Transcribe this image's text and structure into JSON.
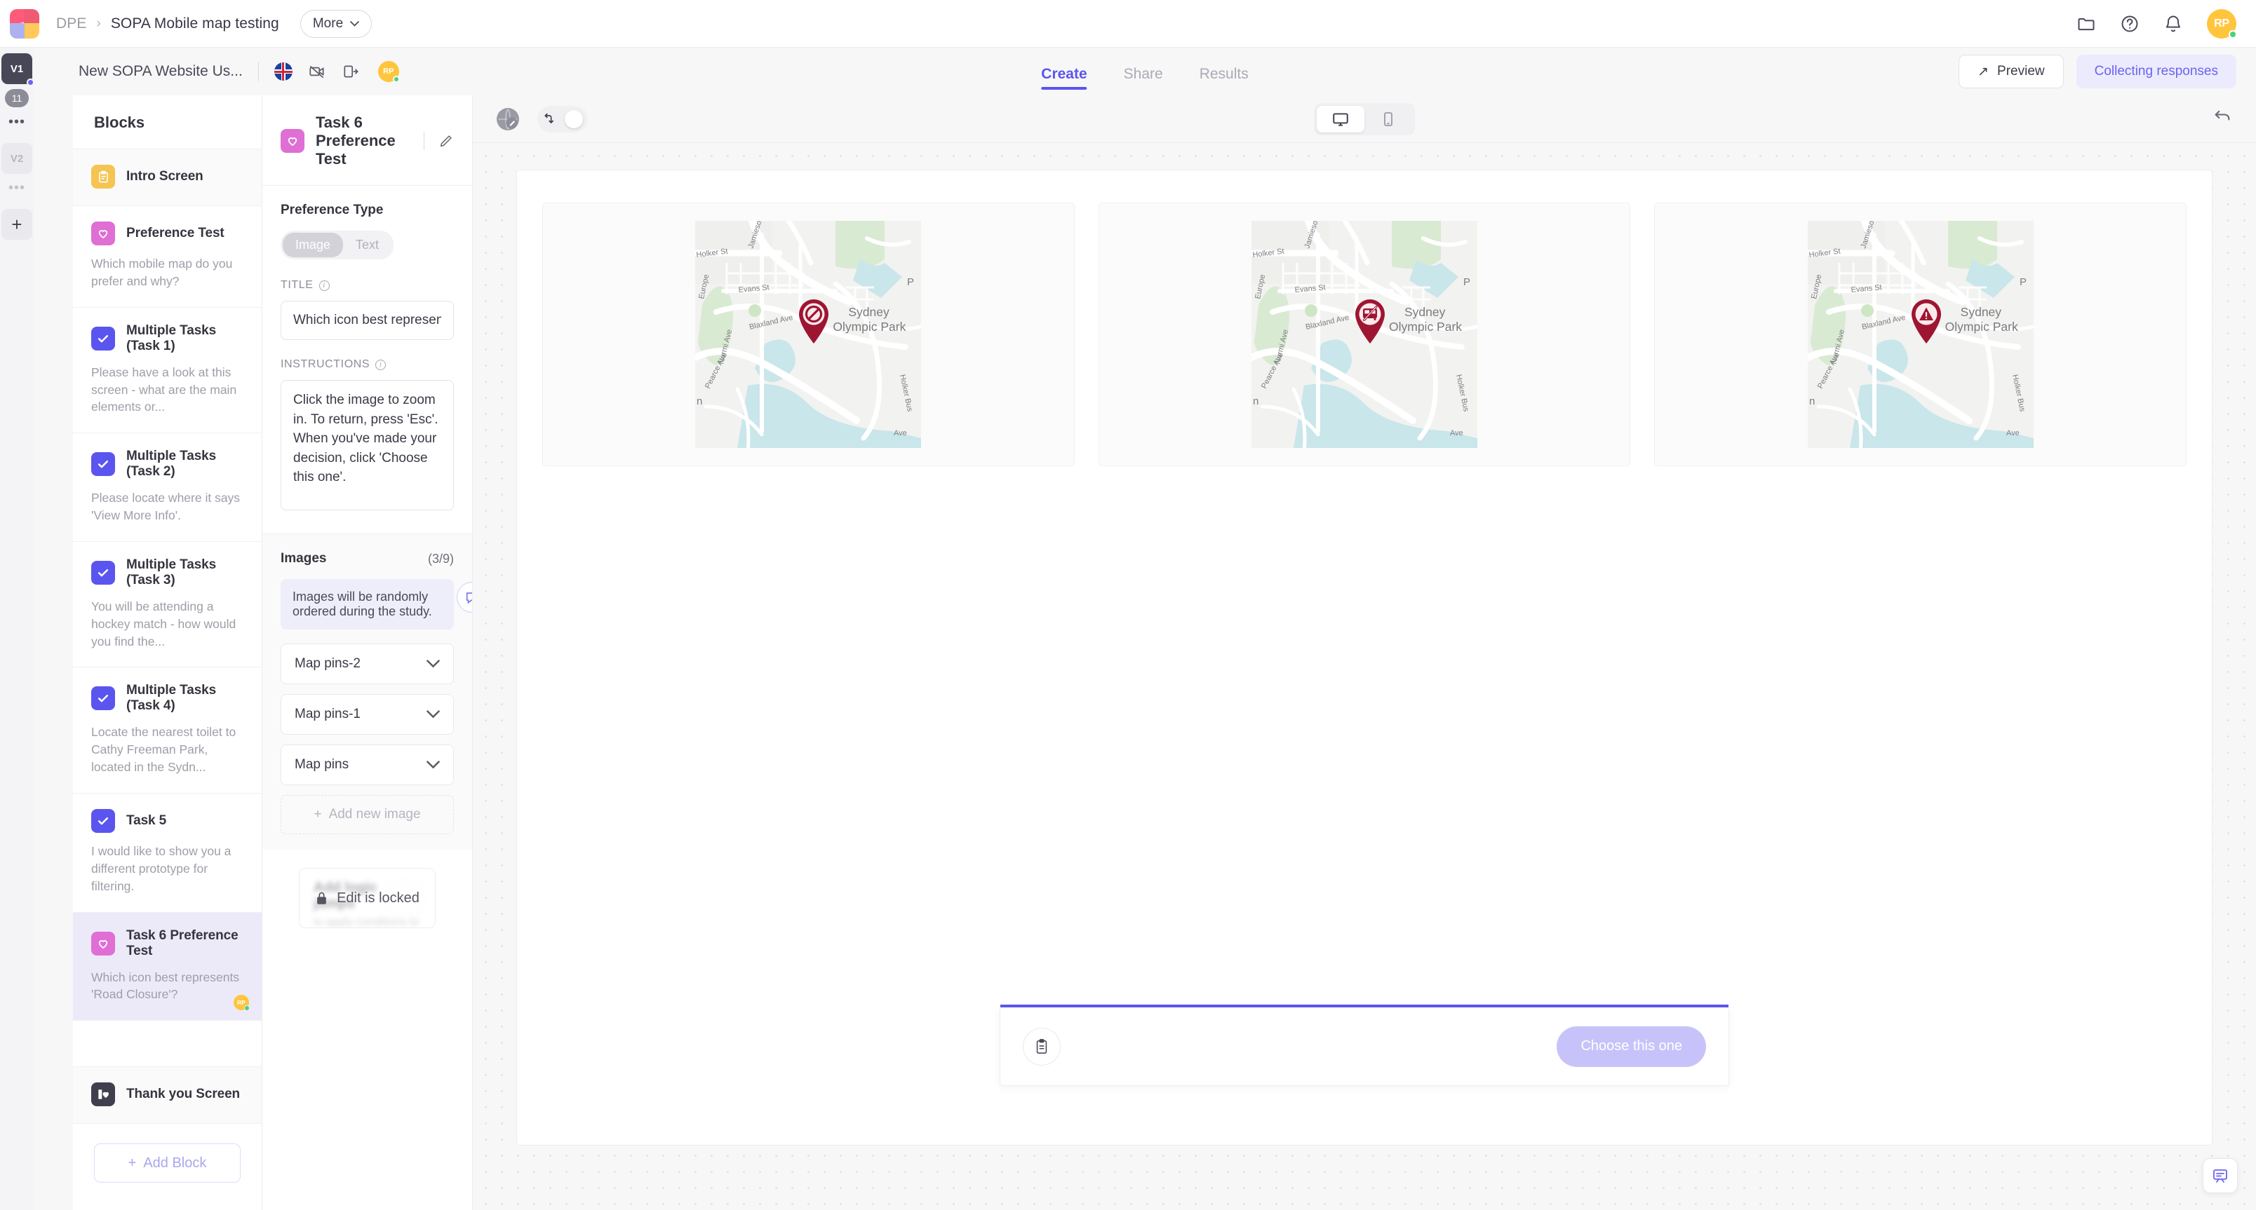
{
  "topbar": {
    "breadcrumb_root": "DPE",
    "breadcrumb_sep": "›",
    "breadcrumb_current": "SOPA Mobile map testing",
    "more_label": "More",
    "more_chevron": "⌄",
    "icons": [
      "folder-icon",
      "help-icon",
      "notifications-icon"
    ],
    "avatar_initials": "RP"
  },
  "rail": {
    "version_1": "V1",
    "badge_count": "11",
    "dots": "•••",
    "version_2": "V2",
    "dots2": "•••",
    "add": "+"
  },
  "subheader": {
    "study_name": "New SOPA Website Us...",
    "flag": "uk-flag-icon",
    "icon_no_video": "video-off-icon",
    "icon_export": "export-icon",
    "avatar_initials": "RP",
    "tabs": [
      {
        "label": "Create",
        "active": true
      },
      {
        "label": "Share",
        "active": false
      },
      {
        "label": "Results",
        "active": false
      }
    ],
    "preview_label": "Preview",
    "preview_arrow": "↗",
    "status_label": "Collecting responses"
  },
  "blocks": {
    "header": "Blocks",
    "items": [
      {
        "title": "Intro Screen",
        "desc": "",
        "icon": "clipboard-icon",
        "color": "yellow",
        "state": "shaded"
      },
      {
        "title": "Preference Test",
        "desc": "Which mobile map do you prefer and why?",
        "icon": "heart-icon",
        "color": "pink",
        "state": ""
      },
      {
        "title": "Multiple Tasks (Task 1)",
        "desc": "Please have a look at this screen - what are the main elements or...",
        "icon": "check-icon",
        "color": "purple",
        "state": ""
      },
      {
        "title": "Multiple Tasks (Task 2)",
        "desc": "Please locate where it says 'View More Info'.",
        "icon": "check-icon",
        "color": "purple",
        "state": ""
      },
      {
        "title": "Multiple Tasks (Task 3)",
        "desc": "You will be attending a hockey match - how would you find the...",
        "icon": "check-icon",
        "color": "purple",
        "state": ""
      },
      {
        "title": "Multiple Tasks (Task 4)",
        "desc": "Locate the nearest toilet to Cathy Freeman Park, located in the Sydn...",
        "icon": "check-icon",
        "color": "purple",
        "state": ""
      },
      {
        "title": "Task 5",
        "desc": "I would like to show you a different prototype for filtering.",
        "icon": "check-icon",
        "color": "purple",
        "state": ""
      },
      {
        "title": "Task 6 Preference Test",
        "desc": "Which icon best represents 'Road Closure'?",
        "icon": "heart-icon",
        "color": "pink",
        "state": "selected",
        "avatar": "RP"
      },
      {
        "title": "Thank you Screen",
        "desc": "",
        "icon": "exit-heart-icon",
        "color": "dark",
        "state": "shaded"
      }
    ],
    "add_block_label": "Add Block",
    "add_block_plus": "+"
  },
  "settings": {
    "block_title": "Task 6 Preference Test",
    "edit_icon": "pencil-icon",
    "preference_type_label": "Preference Type",
    "type_options": [
      {
        "label": "Image",
        "selected": true
      },
      {
        "label": "Text",
        "selected": false
      }
    ],
    "title_label": "TITLE",
    "title_value": "Which icon best represents 'Road Closure'?",
    "instructions_label": "INSTRUCTIONS",
    "instructions_value": "Click the image to zoom in. To return, press 'Esc'. When you've made your decision, click 'Choose this one'.",
    "images_label": "Images",
    "images_count": "(3/9)",
    "images_note": "Images will be randomly ordered during the study.",
    "image_rows": [
      {
        "name": "Map pins-2",
        "chevron": "chevron-down-icon"
      },
      {
        "name": "Map pins-1",
        "chevron": "chevron-down-icon"
      },
      {
        "name": "Map pins",
        "chevron": "chevron-down-icon"
      }
    ],
    "add_image_label": "Add new image",
    "add_image_plus": "+",
    "logic_title": "Add logic jumps",
    "logic_subtitle": "to apply conditions to your blocks",
    "locked_label": "Edit is locked",
    "lock_icon": "lock-icon",
    "comment_fab": "comment-icon"
  },
  "canvas": {
    "globe_icon": "globe-edit-icon",
    "logic_toggle_icon": "logic-jump-icon",
    "device_desktop": "desktop-icon",
    "device_mobile": "mobile-icon",
    "undo_icon": "undo-icon",
    "cards": [
      {
        "pin": "no-entry-icon",
        "label_line1": "Sydney",
        "label_line2": "Olympic Park"
      },
      {
        "pin": "no-bus-icon",
        "label_line1": "Sydney",
        "label_line2": "Olympic Park"
      },
      {
        "pin": "warning-triangle-icon",
        "label_line1": "Sydney",
        "label_line2": "Olympic Park"
      }
    ],
    "map_streets": [
      "Holker St",
      "Jamieson",
      "Evans St",
      "Europe",
      "Blaxland Ave",
      "Nurmi Ave",
      "Pearce Ave",
      "Holker Bus",
      "Ave",
      "P",
      "n"
    ],
    "bottom_clip_icon": "clipboard-icon",
    "choose_label": "Choose this one",
    "fab_icon": "feedback-icon"
  },
  "colors": {
    "accent": "#5b55ef",
    "pin_red": "#9e1532",
    "pink": "#df6fd4",
    "yellow": "#f5c451"
  }
}
